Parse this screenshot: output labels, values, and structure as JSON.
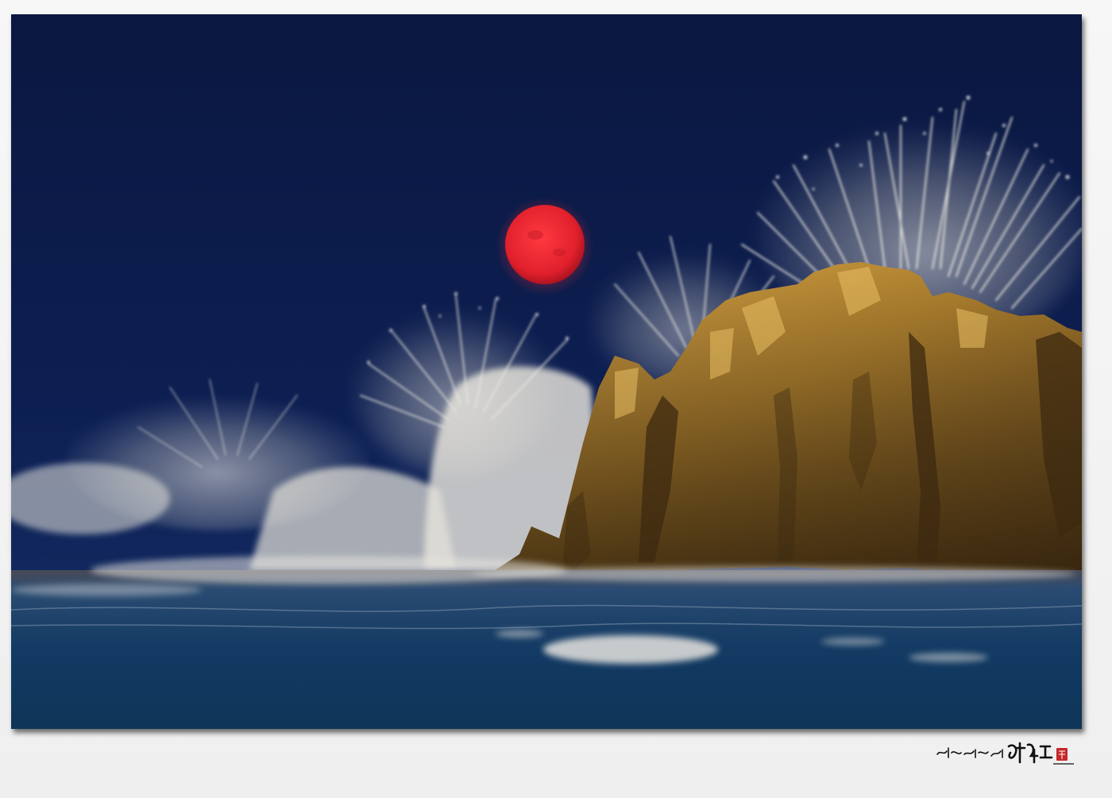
{
  "photo": {
    "subject": "red-moon-over-crashing-waves-and-rock"
  },
  "colors": {
    "sky": "#0b1a47",
    "moon": "#e0202c",
    "rock": "#b0822f",
    "sea": "#123a63",
    "spray": "#f1efe6",
    "frame": "#f2f2f2",
    "seal": "#c62828"
  },
  "signature": {
    "script": "너른세상 안세상 임현규",
    "seal": "seal-stamp"
  }
}
